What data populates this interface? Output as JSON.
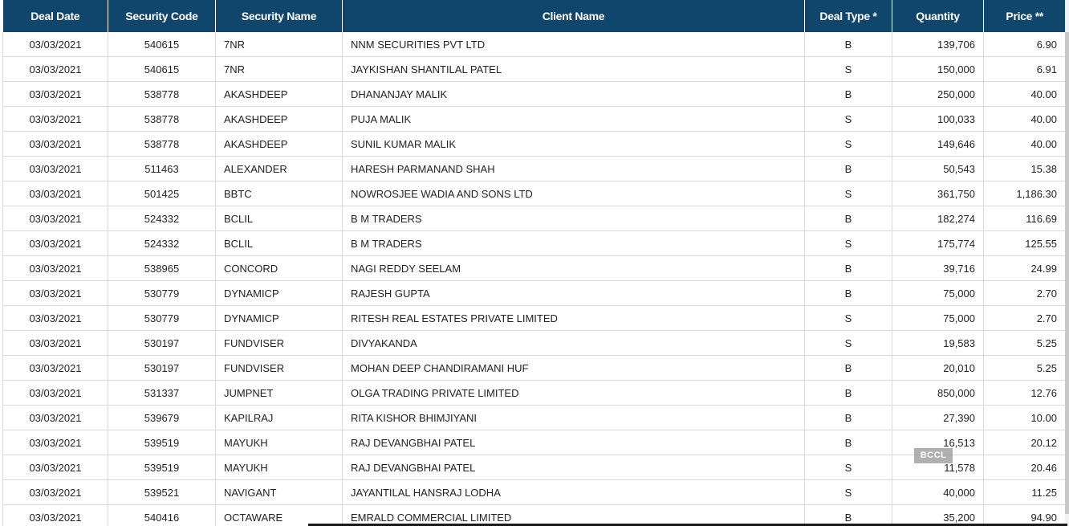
{
  "columns": [
    "Deal Date",
    "Security Code",
    "Security Name",
    "Client Name",
    "Deal Type *",
    "Quantity",
    "Price **"
  ],
  "rows": [
    [
      "03/03/2021",
      "540615",
      "7NR",
      "NNM SECURITIES PVT LTD",
      "B",
      "139,706",
      "6.90"
    ],
    [
      "03/03/2021",
      "540615",
      "7NR",
      "JAYKISHAN SHANTILAL PATEL",
      "S",
      "150,000",
      "6.91"
    ],
    [
      "03/03/2021",
      "538778",
      "AKASHDEEP",
      "DHANANJAY MALIK",
      "B",
      "250,000",
      "40.00"
    ],
    [
      "03/03/2021",
      "538778",
      "AKASHDEEP",
      "PUJA MALIK",
      "S",
      "100,033",
      "40.00"
    ],
    [
      "03/03/2021",
      "538778",
      "AKASHDEEP",
      "SUNIL KUMAR MALIK",
      "S",
      "149,646",
      "40.00"
    ],
    [
      "03/03/2021",
      "511463",
      "ALEXANDER",
      "HARESH PARMANAND SHAH",
      "B",
      "50,543",
      "15.38"
    ],
    [
      "03/03/2021",
      "501425",
      "BBTC",
      "NOWROSJEE WADIA AND SONS LTD",
      "S",
      "361,750",
      "1,186.30"
    ],
    [
      "03/03/2021",
      "524332",
      "BCLIL",
      "B M TRADERS",
      "B",
      "182,274",
      "116.69"
    ],
    [
      "03/03/2021",
      "524332",
      "BCLIL",
      "B M TRADERS",
      "S",
      "175,774",
      "125.55"
    ],
    [
      "03/03/2021",
      "538965",
      "CONCORD",
      "NAGI REDDY SEELAM",
      "B",
      "39,716",
      "24.99"
    ],
    [
      "03/03/2021",
      "530779",
      "DYNAMICP",
      "RAJESH GUPTA",
      "B",
      "75,000",
      "2.70"
    ],
    [
      "03/03/2021",
      "530779",
      "DYNAMICP",
      "RITESH REAL ESTATES PRIVATE LIMITED",
      "S",
      "75,000",
      "2.70"
    ],
    [
      "03/03/2021",
      "530197",
      "FUNDVISER",
      "DIVYAKANDA",
      "S",
      "19,583",
      "5.25"
    ],
    [
      "03/03/2021",
      "530197",
      "FUNDVISER",
      "MOHAN DEEP CHANDIRAMANI HUF",
      "B",
      "20,010",
      "5.25"
    ],
    [
      "03/03/2021",
      "531337",
      "JUMPNET",
      "OLGA TRADING PRIVATE LIMITED",
      "B",
      "850,000",
      "12.76"
    ],
    [
      "03/03/2021",
      "539679",
      "KAPILRAJ",
      "RITA KISHOR BHIMJIYANI",
      "B",
      "27,390",
      "10.00"
    ],
    [
      "03/03/2021",
      "539519",
      "MAYUKH",
      "RAJ DEVANGBHAI PATEL",
      "B",
      "16,513",
      "20.12"
    ],
    [
      "03/03/2021",
      "539519",
      "MAYUKH",
      "RAJ DEVANGBHAI PATEL",
      "S",
      "11,578",
      "20.46"
    ],
    [
      "03/03/2021",
      "539521",
      "NAVIGANT",
      "JAYANTILAL HANSRAJ LODHA",
      "S",
      "40,000",
      "11.25"
    ],
    [
      "03/03/2021",
      "540416",
      "OCTAWARE",
      "EMRALD COMMERCIAL LIMITED",
      "B",
      "35,200",
      "94.90"
    ]
  ],
  "watermark": "BCCL",
  "colors": {
    "header_bg": "#11466c",
    "header_text": "#ffffff",
    "grid": "#d9d9d9"
  }
}
